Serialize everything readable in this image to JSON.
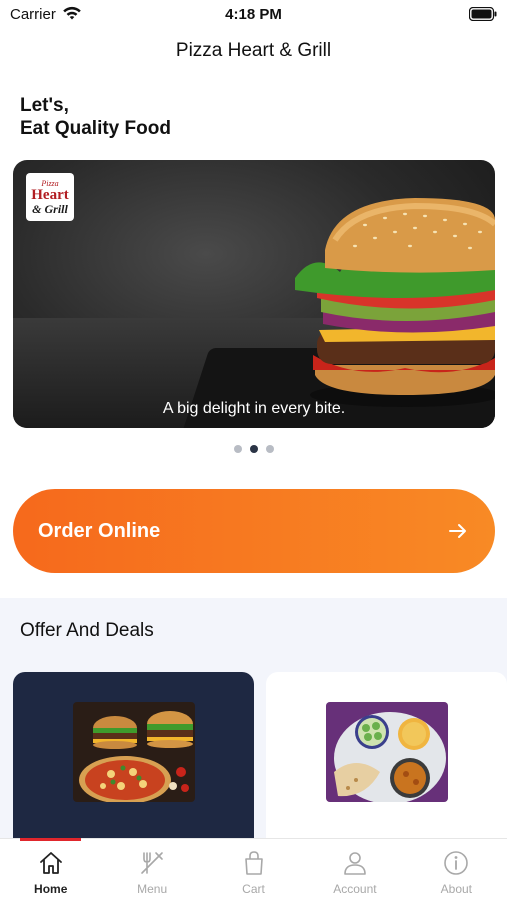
{
  "status_bar": {
    "carrier": "Carrier",
    "time": "4:18 PM"
  },
  "header": {
    "title": "Pizza Heart & Grill"
  },
  "greeting": {
    "line1": "Let's,",
    "line2": "Eat Quality Food"
  },
  "banner": {
    "logo": {
      "line1": "Pizza",
      "line2": "Heart",
      "line3": "& Grill"
    },
    "caption": "A big delight in every bite.",
    "page_count": 3,
    "active_page": 2
  },
  "order": {
    "label": "Order Online",
    "icon": "arrow-right-icon"
  },
  "offers": {
    "title": "Offer And Deals"
  },
  "tabs": [
    {
      "label": "Home",
      "icon": "home-icon",
      "active": true
    },
    {
      "label": "Menu",
      "icon": "fork-knife-icon",
      "active": false
    },
    {
      "label": "Cart",
      "icon": "shopping-bag-icon",
      "active": false
    },
    {
      "label": "Account",
      "icon": "user-icon",
      "active": false
    },
    {
      "label": "About",
      "icon": "info-icon",
      "active": false
    }
  ],
  "colors": {
    "accent": "#f6691c",
    "tab_indicator": "#e0262c",
    "offer_card_dark": "#1e2842"
  }
}
